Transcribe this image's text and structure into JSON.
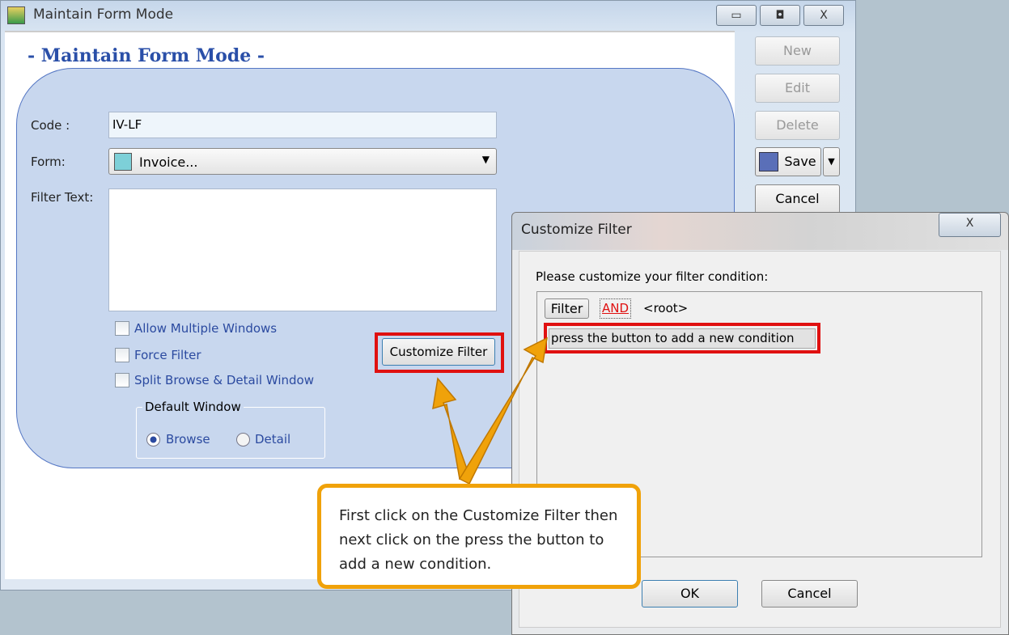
{
  "window": {
    "title": "Maintain Form Mode",
    "minimize": "▭",
    "restore": "◘",
    "close": "X"
  },
  "page_title": "- Maintain Form Mode -",
  "form": {
    "code_label": "Code :",
    "code_value": "IV-LF",
    "form_label": "Form:",
    "form_value": "Invoice...",
    "filter_label": "Filter Text:",
    "filter_value": "",
    "checkboxes": [
      {
        "label": "Allow Multiple Windows",
        "checked": false
      },
      {
        "label": "Force Filter",
        "checked": false
      },
      {
        "label": "Split Browse & Detail Window",
        "checked": false
      }
    ],
    "default_window": {
      "legend": "Default Window",
      "options": [
        {
          "label": "Browse",
          "selected": true
        },
        {
          "label": "Detail",
          "selected": false
        }
      ]
    },
    "customize_filter": "Customize Filter"
  },
  "side_buttons": {
    "new": "New",
    "edit": "Edit",
    "delete": "Delete",
    "save": "Save",
    "cancel": "Cancel"
  },
  "dialog": {
    "title": "Customize Filter",
    "close": "X",
    "prompt": "Please customize your filter condition:",
    "filter_btn": "Filter",
    "and": "AND",
    "root": "<root>",
    "add_condition": "press the button to add a new condition",
    "ok": "OK",
    "cancel": "Cancel"
  },
  "callout": "First click on the Customize Filter then next click on the press the button to add a new condition.",
  "colors": {
    "accent": "#2a4fa8",
    "highlight": "#e01010",
    "callout": "#f0a20a"
  }
}
